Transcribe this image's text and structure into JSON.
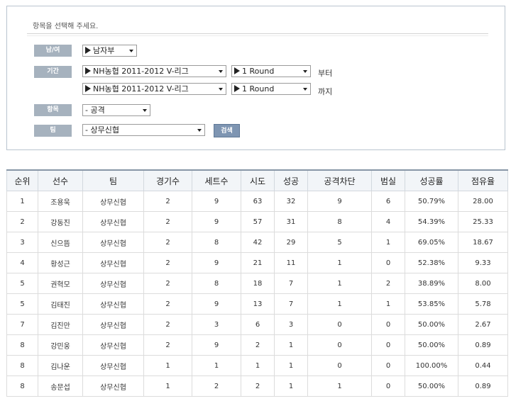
{
  "filter": {
    "title": "항목을 선택해 주세요.",
    "gender": {
      "label": "남/여",
      "value": "남자부"
    },
    "period": {
      "label": "기간",
      "from": {
        "season": "NH농협 2011-2012 V-리그",
        "round": "1 Round",
        "suffix": "부터"
      },
      "to": {
        "season": "NH농협 2011-2012 V-리그",
        "round": "1 Round",
        "suffix": "까지"
      }
    },
    "item": {
      "label": "항목",
      "value": "- 공격"
    },
    "team": {
      "label": "팀",
      "value": "- 상무신협"
    },
    "search_label": "검색"
  },
  "table": {
    "headers": [
      "순위",
      "선수",
      "팀",
      "경기수",
      "세트수",
      "시도",
      "성공",
      "공격차단",
      "범실",
      "성공률",
      "점유율"
    ],
    "rows": [
      [
        "1",
        "조용욱",
        "상무신협",
        "2",
        "9",
        "63",
        "32",
        "9",
        "6",
        "50.79%",
        "28.00"
      ],
      [
        "2",
        "강동진",
        "상무신협",
        "2",
        "9",
        "57",
        "31",
        "8",
        "4",
        "54.39%",
        "25.33"
      ],
      [
        "3",
        "신으뜸",
        "상무신협",
        "2",
        "8",
        "42",
        "29",
        "5",
        "1",
        "69.05%",
        "18.67"
      ],
      [
        "4",
        "황성근",
        "상무신협",
        "2",
        "9",
        "21",
        "11",
        "1",
        "0",
        "52.38%",
        "9.33"
      ],
      [
        "5",
        "권혁모",
        "상무신협",
        "2",
        "8",
        "18",
        "7",
        "1",
        "2",
        "38.89%",
        "8.00"
      ],
      [
        "5",
        "김태진",
        "상무신협",
        "2",
        "9",
        "13",
        "7",
        "1",
        "1",
        "53.85%",
        "5.78"
      ],
      [
        "7",
        "김진만",
        "상무신협",
        "2",
        "3",
        "6",
        "3",
        "0",
        "0",
        "50.00%",
        "2.67"
      ],
      [
        "8",
        "강민웅",
        "상무신협",
        "2",
        "9",
        "2",
        "1",
        "0",
        "0",
        "50.00%",
        "0.89"
      ],
      [
        "8",
        "김나운",
        "상무신협",
        "1",
        "1",
        "1",
        "1",
        "0",
        "0",
        "100.00%",
        "0.44"
      ],
      [
        "8",
        "송문섭",
        "상무신협",
        "1",
        "2",
        "2",
        "1",
        "1",
        "0",
        "50.00%",
        "0.89"
      ]
    ]
  }
}
